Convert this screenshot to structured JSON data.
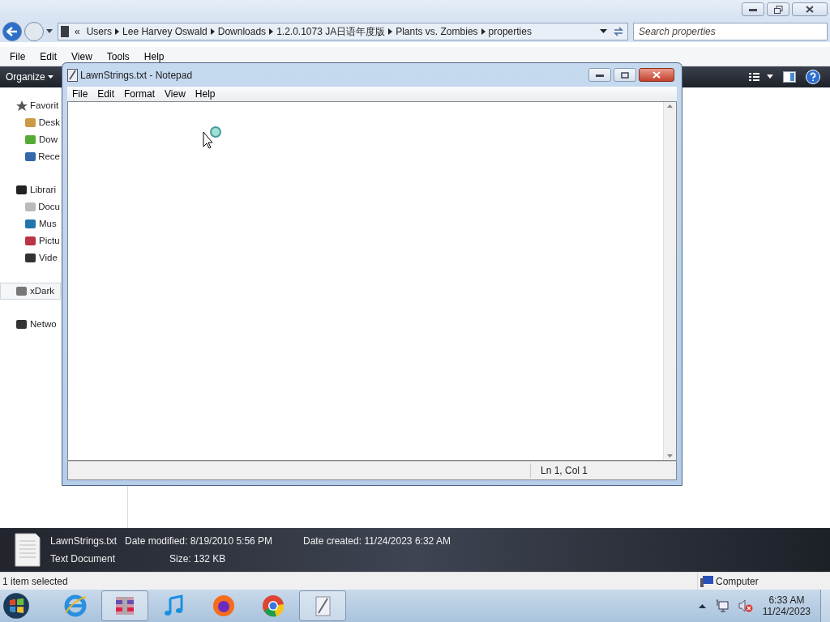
{
  "explorer": {
    "breadcrumb": [
      "Users",
      "Lee Harvey Oswald",
      "Downloads",
      "1.2.0.1073 JA日语年度版",
      "Plants vs. Zombies",
      "properties"
    ],
    "breadcrumb_overflow": "«",
    "search": {
      "placeholder": "Search properties"
    },
    "menu": [
      "File",
      "Edit",
      "View",
      "Tools",
      "Help"
    ],
    "organize": "Organize",
    "nav": [
      {
        "label": "Favorit",
        "selected": false,
        "children": [
          {
            "label": "Desk",
            "selected": false
          },
          {
            "label": "Dow",
            "selected": false
          },
          {
            "label": "Rece",
            "selected": false
          }
        ]
      },
      {
        "label": "Librari",
        "selected": false,
        "children": [
          {
            "label": "Docu",
            "selected": false
          },
          {
            "label": "Mus",
            "selected": false
          },
          {
            "label": "Pictu",
            "selected": false
          },
          {
            "label": "Vide",
            "selected": false
          }
        ]
      },
      {
        "label": "xDark",
        "selected": true
      },
      {
        "label": "Netwo",
        "selected": false
      }
    ],
    "details": {
      "name": "LawnStrings.txt",
      "type": "Text Document",
      "fields": [
        "Date modified: 8/19/2010 5:56 PM",
        "Size: 132 KB",
        "Date created: 11/24/2023 6:32 AM"
      ]
    },
    "status_bar": {
      "text": "1 item selected",
      "location": "Computer"
    }
  },
  "notepad": {
    "title": "LawnStrings.txt - Notepad",
    "menu": [
      "File",
      "Edit",
      "Format",
      "View",
      "Help"
    ],
    "status": "Ln 1, Col 1"
  },
  "taskbar": {
    "apps": [
      {
        "selected": false
      },
      {
        "selected": true
      },
      {
        "selected": false
      },
      {
        "selected": false
      },
      {
        "selected": false
      },
      {
        "selected": true
      }
    ],
    "clock": {
      "time": "6:33 AM",
      "date": "11/24/2023"
    }
  }
}
